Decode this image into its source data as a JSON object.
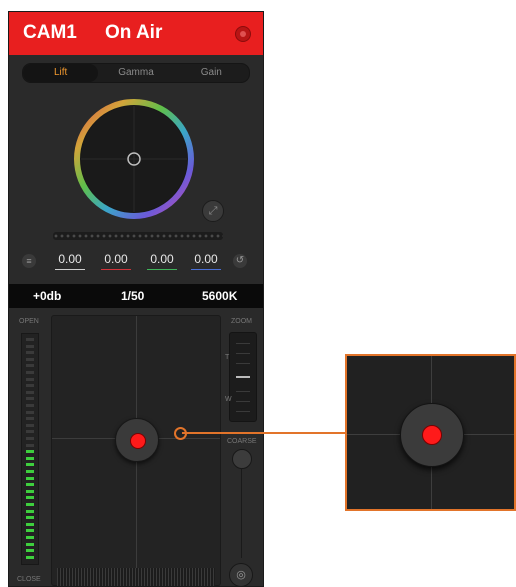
{
  "header": {
    "camera": "CAM1",
    "status": "On Air"
  },
  "tabs": [
    {
      "label": "Lift",
      "active": true
    },
    {
      "label": "Gamma",
      "active": false
    },
    {
      "label": "Gain",
      "active": false
    }
  ],
  "color_values": [
    {
      "value": "0.00",
      "color": "#cfcfcf"
    },
    {
      "value": "0.00",
      "color": "#d0333b"
    },
    {
      "value": "0.00",
      "color": "#3fb45a"
    },
    {
      "value": "0.00",
      "color": "#4a6fd6"
    }
  ],
  "infobar": {
    "gain": "+0db",
    "shutter": "1/50",
    "white_balance": "5600K"
  },
  "lower": {
    "iris_label_top": "OPEN",
    "iris_label_bottom": "CLOSE",
    "zoom_label": "ZOOM",
    "zoom_tele": "T",
    "zoom_wide": "W",
    "coarse_label": "COARSE"
  },
  "colors": {
    "on_air_red": "#e81f1f",
    "accent_orange": "#f2992e",
    "callout_orange": "#e2742a",
    "meter_green": "#3ecf3e"
  },
  "icons": [
    "record-icon",
    "menu-icon",
    "expand-icon",
    "reset-icon",
    "focus-icon"
  ]
}
